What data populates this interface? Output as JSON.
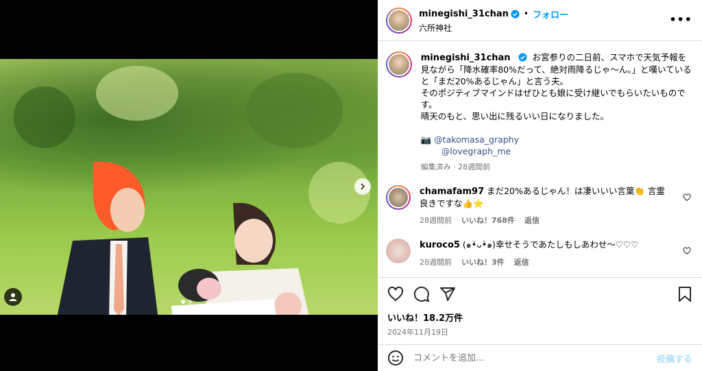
{
  "post": {
    "username": "minegishi_31chan",
    "follow_label": "フォロー",
    "separator": "•",
    "location": "六所神社",
    "more_label": "•••"
  },
  "caption": {
    "username": "minegishi_31chan",
    "lines": [
      "お宮参りの二日前、スマホで天気予報を見ながら「降水確率80%だって、絶対雨降るじゃ〜ん。」と嘆いていると「まだ20%あるじゃん」と言う夫。",
      "そのポジティブマインドはぜひとも娘に受け継いでもらいたいものです。",
      "晴天のもと、思い出に残るいい日になりました。"
    ],
    "camera_emoji": "📷",
    "mention_1": "@takomasa_graphy",
    "mention_2": "@lovegraph_me",
    "meta": "編集済み · 28週間前"
  },
  "comments": [
    {
      "username": "chamafam97",
      "text": "まだ20%あるじゃん！は凄いいい言葉👏 言霊良きですな👍⭐",
      "time": "28週間前",
      "likes": "いいね！768件",
      "reply": "返信"
    },
    {
      "username": "kuroco5",
      "text": "(๑•̀ᴗ•̀๑)幸せそうであたしもしあわせ〜♡♡♡",
      "time": "28週間前",
      "likes": "いいね！3件",
      "reply": "返信"
    }
  ],
  "stats": {
    "likes": "いいね！18.2万件",
    "date": "2024年11月19日"
  },
  "add_comment": {
    "placeholder": "コメントを追加...",
    "post_label": "投稿する"
  },
  "carousel": {
    "slide_count": 2,
    "active_slide": 1
  },
  "colors": {
    "accent": "#0095f6",
    "verified": "#0095f6",
    "meta": "#737373"
  }
}
